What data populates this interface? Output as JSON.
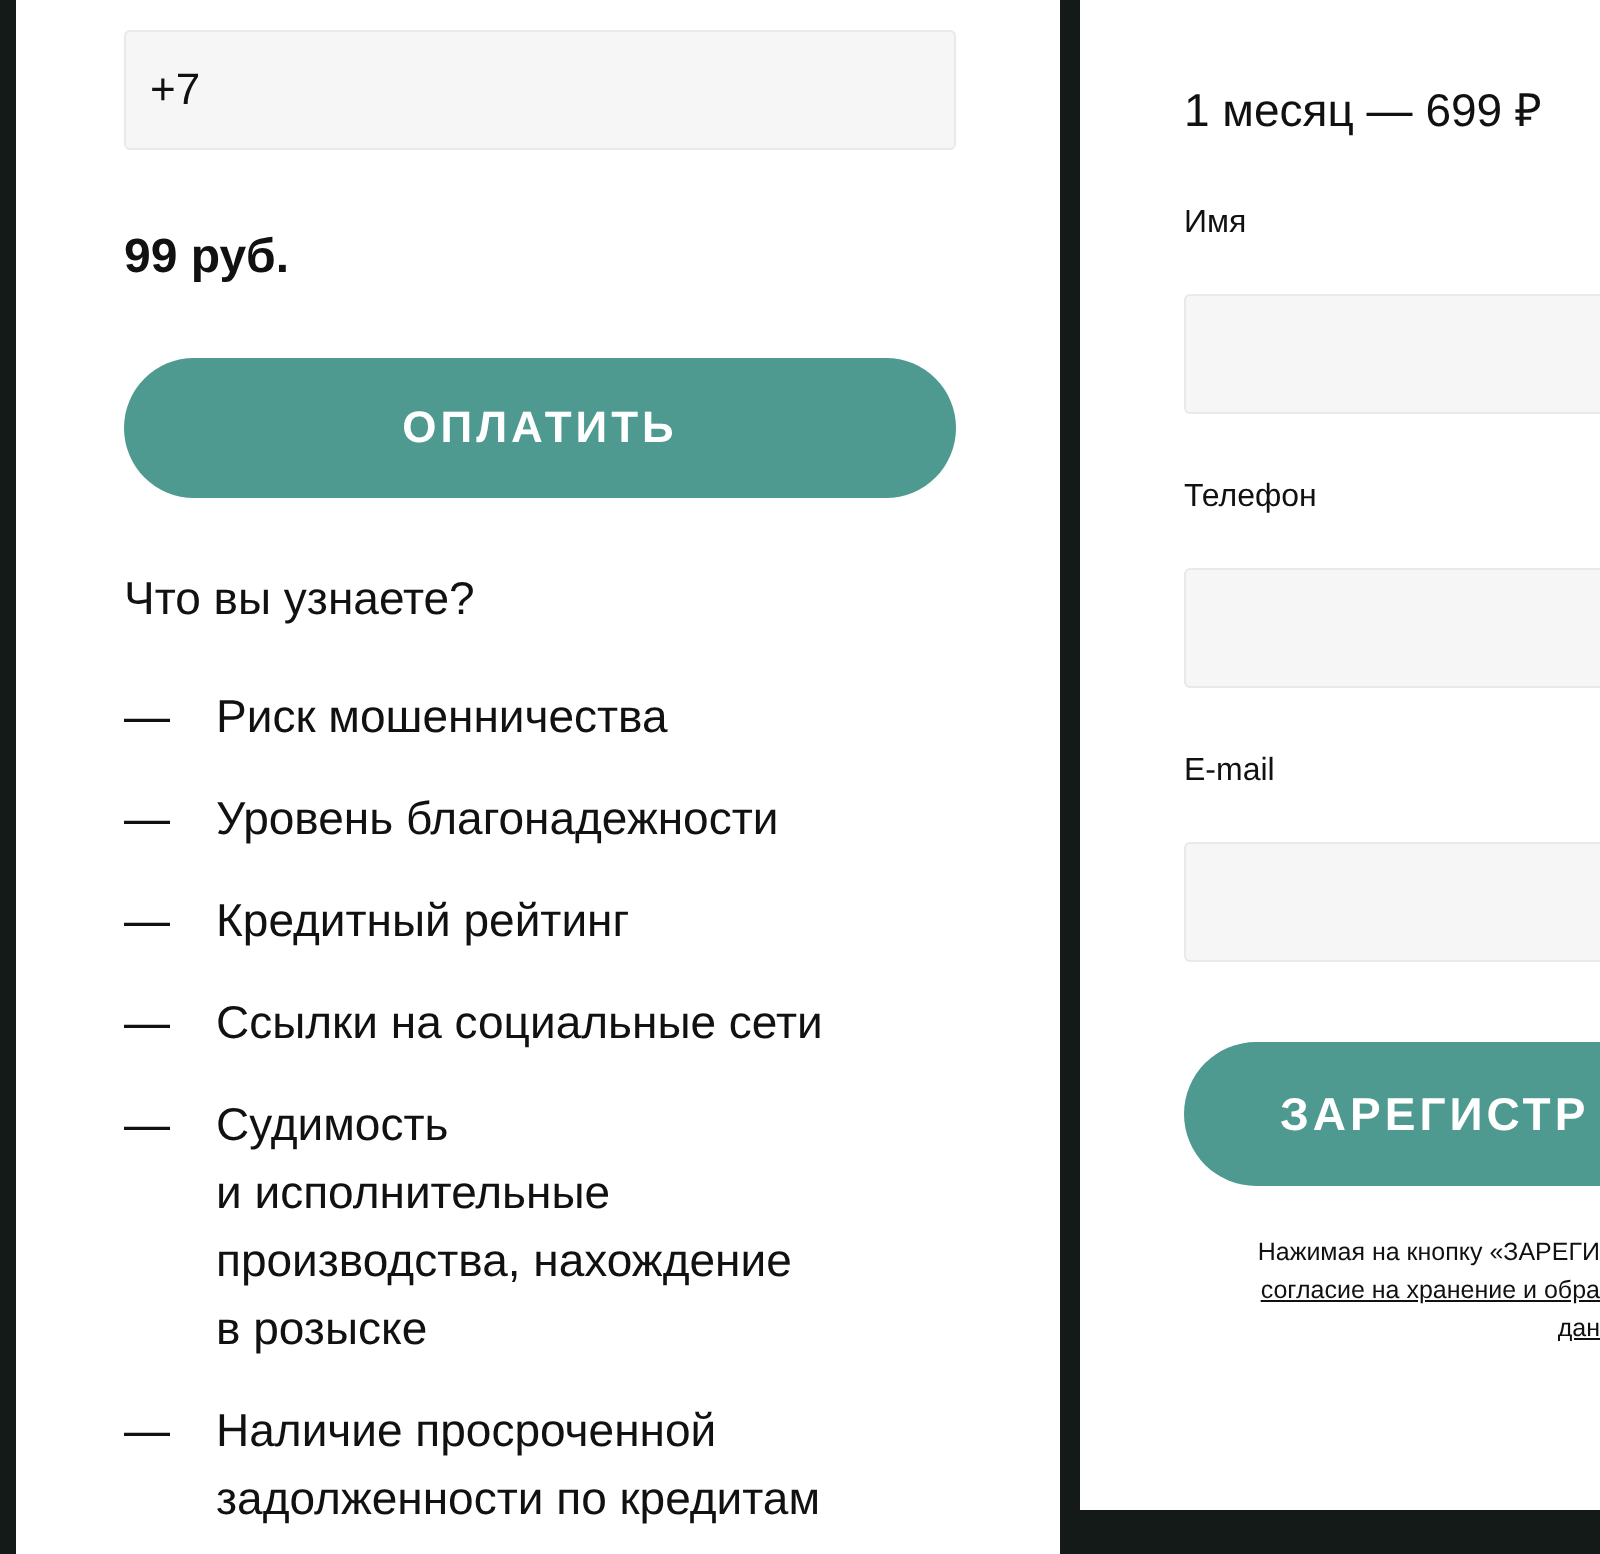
{
  "payment_panel": {
    "phone_field": {
      "value": "+7"
    },
    "price": "99 руб.",
    "pay_button": "ОПЛАТИТЬ",
    "features_heading": "Что вы узнаете?",
    "features": [
      {
        "marker": "—",
        "text": "Риск мошенничества"
      },
      {
        "marker": "—",
        "text": "Уровень благонадежности"
      },
      {
        "marker": "—",
        "text": "Кредитный рейтинг"
      },
      {
        "marker": "—",
        "text": "Ссылки на социальные сети"
      },
      {
        "marker": "—",
        "text": "Судимость\nи исполнительные\nпроизводства, нахождение\nв розыске"
      },
      {
        "marker": "—",
        "text": "Наличие просроченной\nзадолженности по кредитам"
      }
    ]
  },
  "registration_panel": {
    "plan": "1 месяц — 699 ₽",
    "fields": [
      {
        "label": "Имя"
      },
      {
        "label": "Телефон"
      },
      {
        "label": "E-mail"
      }
    ],
    "register_button": "ЗАРЕГИСТР",
    "consent_lines": [
      {
        "text": "Нажимая на кнопку «ЗАРЕГИ",
        "link": false
      },
      {
        "text": "согласие на хранение и обра",
        "link": true
      },
      {
        "text": "дан",
        "link": true
      }
    ]
  }
}
